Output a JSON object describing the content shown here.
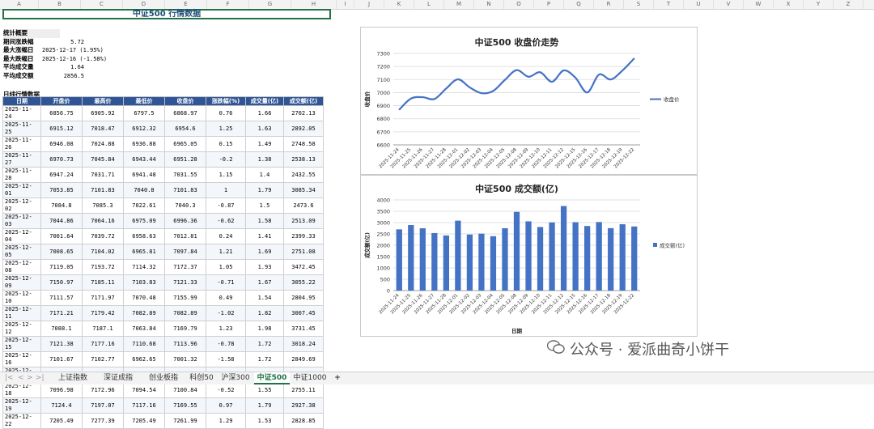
{
  "columns": [
    "A",
    "B",
    "C",
    "D",
    "E",
    "F",
    "G",
    "H",
    "I",
    "J",
    "K",
    "L",
    "M",
    "N",
    "O",
    "P",
    "Q",
    "R",
    "S",
    "T",
    "U",
    "V",
    "W",
    "X",
    "Y",
    "Z",
    "AA"
  ],
  "sheet_title": "中证500 行情数据",
  "stats": {
    "header": "统计概要",
    "rows": [
      {
        "label": "期间涨跌幅",
        "value": "5.72"
      },
      {
        "label": "最大涨幅日",
        "value": "2025-12-17 (1.95%)"
      },
      {
        "label": "最大跌幅日",
        "value": "2025-12-16 (-1.58%)"
      },
      {
        "label": "平均成交量",
        "value": "1.64"
      },
      {
        "label": "平均成交额",
        "value": "2856.5"
      }
    ]
  },
  "table_title": "日线行情数据",
  "table": {
    "headers": [
      "日期",
      "开盘价",
      "最高价",
      "最低价",
      "收盘价",
      "涨跌幅(%)",
      "成交量(亿)",
      "成交额(亿)"
    ],
    "rows": [
      [
        "2025-11-24",
        "6856.75",
        "6905.92",
        "6797.5",
        "6868.97",
        "0.76",
        "1.66",
        "2702.13"
      ],
      [
        "2025-11-25",
        "6915.12",
        "7018.47",
        "6912.32",
        "6954.6",
        "1.25",
        "1.63",
        "2892.05"
      ],
      [
        "2025-11-26",
        "6946.08",
        "7024.88",
        "6936.88",
        "6965.05",
        "0.15",
        "1.49",
        "2748.58"
      ],
      [
        "2025-11-27",
        "6970.73",
        "7045.84",
        "6943.44",
        "6951.28",
        "-0.2",
        "1.38",
        "2538.13"
      ],
      [
        "2025-11-28",
        "6947.24",
        "7031.71",
        "6941.48",
        "7031.55",
        "1.15",
        "1.4",
        "2432.55"
      ],
      [
        "2025-12-01",
        "7053.85",
        "7101.83",
        "7040.8",
        "7101.83",
        "1",
        "1.79",
        "3085.34"
      ],
      [
        "2025-12-02",
        "7084.8",
        "7085.3",
        "7022.61",
        "7040.3",
        "-0.87",
        "1.5",
        "2473.6"
      ],
      [
        "2025-12-03",
        "7044.86",
        "7064.16",
        "6975.09",
        "6996.36",
        "-0.62",
        "1.58",
        "2513.09"
      ],
      [
        "2025-12-04",
        "7001.64",
        "7039.72",
        "6958.63",
        "7012.81",
        "0.24",
        "1.41",
        "2399.33"
      ],
      [
        "2025-12-05",
        "7008.65",
        "7104.02",
        "6965.81",
        "7097.84",
        "1.21",
        "1.69",
        "2751.08"
      ],
      [
        "2025-12-08",
        "7119.05",
        "7193.72",
        "7114.32",
        "7172.37",
        "1.05",
        "1.93",
        "3472.45"
      ],
      [
        "2025-12-09",
        "7150.97",
        "7185.11",
        "7103.83",
        "7121.33",
        "-0.71",
        "1.67",
        "3055.22"
      ],
      [
        "2025-12-10",
        "7111.57",
        "7171.97",
        "7070.48",
        "7155.99",
        "0.49",
        "1.54",
        "2804.95"
      ],
      [
        "2025-12-11",
        "7171.21",
        "7179.42",
        "7082.89",
        "7082.89",
        "-1.02",
        "1.82",
        "3007.45"
      ],
      [
        "2025-12-12",
        "7088.1",
        "7187.1",
        "7063.84",
        "7169.79",
        "1.23",
        "1.98",
        "3731.45"
      ],
      [
        "2025-12-15",
        "7121.38",
        "7177.16",
        "7110.68",
        "7113.96",
        "-0.78",
        "1.72",
        "3018.24"
      ],
      [
        "2025-12-16",
        "7101.67",
        "7102.77",
        "6962.65",
        "7001.32",
        "-1.58",
        "1.72",
        "2849.69"
      ],
      [
        "2025-12-17",
        "7002.51",
        "7160.78",
        "6988.87",
        "7137.83",
        "1.95",
        "1.74",
        "3024.1"
      ],
      [
        "2025-12-18",
        "7096.98",
        "7172.96",
        "7094.54",
        "7100.84",
        "-0.52",
        "1.55",
        "2755.11"
      ],
      [
        "2025-12-19",
        "7124.4",
        "7197.07",
        "7117.16",
        "7169.55",
        "0.97",
        "1.79",
        "2927.38"
      ],
      [
        "2025-12-22",
        "7205.49",
        "7277.39",
        "7205.49",
        "7261.99",
        "1.29",
        "1.53",
        "2828.85"
      ]
    ]
  },
  "chart_data": [
    {
      "type": "line",
      "title": "中证500 收盘价走势",
      "xlabel": "",
      "ylabel": "收盘价",
      "ylim": [
        6600,
        7300
      ],
      "yticks": [
        6600,
        6700,
        6800,
        6900,
        7000,
        7100,
        7200,
        7300
      ],
      "categories": [
        "2025-11-24",
        "2025-11-25",
        "2025-11-26",
        "2025-11-27",
        "2025-11-28",
        "2025-12-01",
        "2025-12-02",
        "2025-12-03",
        "2025-12-04",
        "2025-12-05",
        "2025-12-08",
        "2025-12-09",
        "2025-12-10",
        "2025-12-11",
        "2025-12-12",
        "2025-12-15",
        "2025-12-16",
        "2025-12-17",
        "2025-12-18",
        "2025-12-19",
        "2025-12-22"
      ],
      "series": [
        {
          "name": "收盘价",
          "values": [
            6868.97,
            6954.6,
            6965.05,
            6951.28,
            7031.55,
            7101.83,
            7040.3,
            6996.36,
            7012.81,
            7097.84,
            7172.37,
            7121.33,
            7155.99,
            7082.89,
            7169.79,
            7113.96,
            7001.32,
            7137.83,
            7100.84,
            7169.55,
            7261.99
          ]
        }
      ],
      "color": "#4472c4",
      "grid": true,
      "legend": "right"
    },
    {
      "type": "bar",
      "title": "中证500 成交额(亿)",
      "xlabel": "日期",
      "ylabel": "成交额(亿)",
      "ylim": [
        0,
        4000
      ],
      "yticks": [
        0,
        500,
        1000,
        1500,
        2000,
        2500,
        3000,
        3500,
        4000
      ],
      "categories": [
        "2025-11-24",
        "2025-11-25",
        "2025-11-26",
        "2025-11-27",
        "2025-11-28",
        "2025-12-01",
        "2025-12-02",
        "2025-12-03",
        "2025-12-04",
        "2025-12-05",
        "2025-12-08",
        "2025-12-09",
        "2025-12-10",
        "2025-12-11",
        "2025-12-12",
        "2025-12-15",
        "2025-12-16",
        "2025-12-17",
        "2025-12-18",
        "2025-12-19",
        "2025-12-22"
      ],
      "series": [
        {
          "name": "成交额(亿)",
          "values": [
            2702.13,
            2892.05,
            2748.58,
            2538.13,
            2432.55,
            3085.34,
            2473.6,
            2513.09,
            2399.33,
            2751.08,
            3472.45,
            3055.22,
            2804.95,
            3007.45,
            3731.45,
            3018.24,
            2849.69,
            3024.1,
            2755.11,
            2927.38,
            2828.85
          ]
        }
      ],
      "color": "#4472c4",
      "grid": true,
      "legend": "right"
    }
  ],
  "sheet_tabs": [
    "上证指数",
    "深证成指",
    "创业板指",
    "科创50",
    "沪深300",
    "中证500",
    "中证1000"
  ],
  "active_tab": "中证500",
  "add_tab_symbol": "+",
  "nav_symbols": [
    "|<",
    "<",
    ">",
    ">|"
  ],
  "watermark": "公众号 · 爱派曲奇小饼干"
}
